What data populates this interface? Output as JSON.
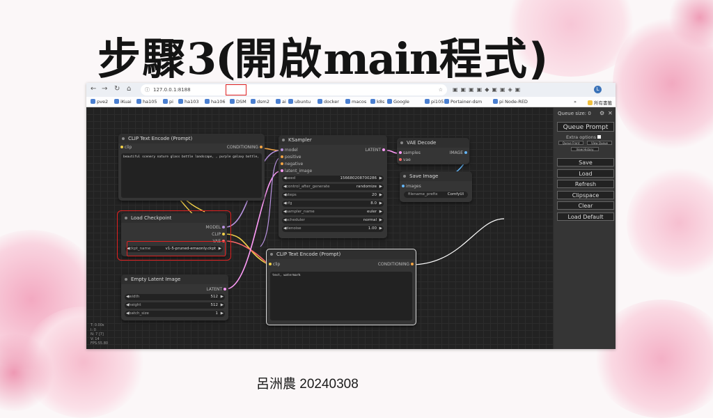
{
  "slide": {
    "title_part1": "步驟",
    "title_part2": "3(",
    "title_part3": "開啟",
    "title_part4": "main",
    "title_part5": "程式)",
    "footer": "呂洲農 20240308"
  },
  "browser": {
    "url": "127.0.0.1:8188",
    "bookmarks": [
      "pve2",
      "iKuai",
      "ha105",
      "pi",
      "ha103",
      "ha106",
      "DSM",
      "dsm2",
      "ai",
      "ubuntu",
      "docker",
      "macos",
      "k8s",
      "Google",
      "pi105",
      "Portainer-dsm",
      "pi Node-RED"
    ],
    "bookmarks_overflow": "»",
    "all_bookmarks": "所有書籤",
    "avatar": "L"
  },
  "colors": {
    "highlight_red": "#e02020",
    "accent_pink": "#f3a9c1"
  },
  "nodes": {
    "clip1": {
      "title": "CLIP Text Encode (Prompt)",
      "input": "clip",
      "output": "CONDITIONING",
      "text": "beautiful scenery nature glass bottle landscape, , purple galaxy bottle,"
    },
    "ksampler": {
      "title": "KSampler",
      "inputs": [
        "model",
        "positive",
        "negative",
        "latent_image"
      ],
      "output": "LATENT",
      "widgets": [
        {
          "label": "seed",
          "value": "156680208700286"
        },
        {
          "label": "control_after_generate",
          "value": "randomize"
        },
        {
          "label": "steps",
          "value": "20"
        },
        {
          "label": "cfg",
          "value": "8.0"
        },
        {
          "label": "sampler_name",
          "value": "euler"
        },
        {
          "label": "scheduler",
          "value": "normal"
        },
        {
          "label": "denoise",
          "value": "1.00"
        }
      ]
    },
    "vae_decode": {
      "title": "VAE Decode",
      "inputs": [
        "samples",
        "vae"
      ],
      "output": "IMAGE"
    },
    "save_image": {
      "title": "Save Image",
      "input": "images",
      "widget_label": "filename_prefix",
      "widget_value": "ComfyUI"
    },
    "load_checkpoint": {
      "title": "Load Checkpoint",
      "outputs": [
        "MODEL",
        "CLIP",
        "VAE"
      ],
      "widget_label": "ckpt_name",
      "widget_value": "v1-5-pruned-emaonly.ckpt"
    },
    "clip2": {
      "title": "CLIP Text Encode (Prompt)",
      "input": "clip",
      "output": "CONDITIONING",
      "text": "text, watermark"
    },
    "empty_latent": {
      "title": "Empty Latent Image",
      "output": "LATENT",
      "widgets": [
        {
          "label": "width",
          "value": "512"
        },
        {
          "label": "height",
          "value": "512"
        },
        {
          "label": "batch_size",
          "value": "1"
        }
      ]
    }
  },
  "stats": "T: 0.00s\nI: 0\nN: 7 [7]\nV: 14\nFPS:55.80",
  "panel": {
    "queue_size": "Queue size: 0",
    "queue_prompt": "Queue Prompt",
    "extra_options": "Extra options",
    "queue_front": "Queue Front",
    "view_queue": "View Queue",
    "view_history": "View History",
    "buttons": [
      "Save",
      "Load",
      "Refresh",
      "Clipspace",
      "Clear",
      "Load Default"
    ]
  }
}
